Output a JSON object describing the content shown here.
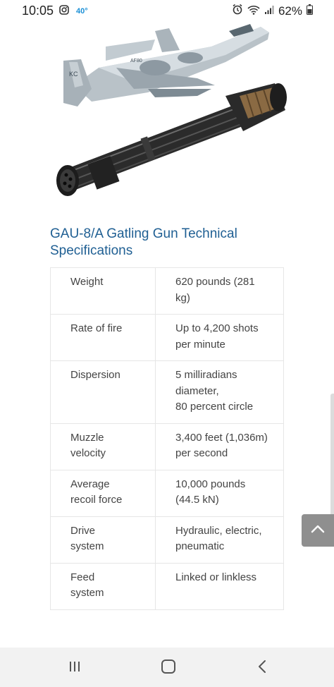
{
  "status_bar": {
    "time": "10:05",
    "temperature": "40°",
    "battery": "62%",
    "icons": [
      "instagram-icon",
      "alarm-icon",
      "wifi-icon",
      "signal-icon",
      "battery-icon"
    ]
  },
  "content": {
    "title": "GAU-8/A Gatling Gun Technical Specifications",
    "specs": [
      {
        "label": "Weight",
        "value": [
          "620 pounds (281",
          "kg)"
        ]
      },
      {
        "label": "Rate of fire",
        "value": [
          "Up to 4,200 shots",
          "per minute"
        ]
      },
      {
        "label": "Dispersion",
        "value": [
          "5 milliradians",
          "diameter,",
          "80 percent circle"
        ]
      },
      {
        "label": "Muzzle velocity",
        "label_lines": [
          "Muzzle",
          "velocity"
        ],
        "value": [
          "3,400 feet (1,036m)",
          "per second"
        ]
      },
      {
        "label": "Average recoil force",
        "label_lines": [
          "Average",
          "recoil force"
        ],
        "value": [
          "10,000 pounds",
          "(44.5 kN)"
        ]
      },
      {
        "label": "Drive system",
        "label_lines": [
          "Drive",
          "system"
        ],
        "value": [
          "Hydraulic, electric,",
          "pneumatic"
        ]
      },
      {
        "label": "Feed system",
        "label_lines": [
          "Feed",
          "system"
        ],
        "value": [
          "Linked or linkless"
        ]
      }
    ]
  },
  "controls": {
    "scroll_top_icon": "chevron-up-icon"
  },
  "nav_bar": {
    "icons": [
      "recent-apps-icon",
      "home-icon",
      "back-icon"
    ]
  },
  "colors": {
    "title": "#1f5f93",
    "temperature": "#1a8fd6",
    "top_button": "#8f8f8f",
    "nav_bar": "#f2f2f2"
  }
}
